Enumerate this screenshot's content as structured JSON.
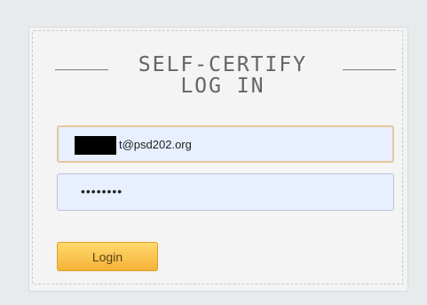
{
  "form": {
    "title_line1": "SELF-CERTIFY",
    "title_line2": "LOG IN",
    "email_value": "t@psd202.org",
    "password_value": "••••••••",
    "login_label": "Login"
  }
}
